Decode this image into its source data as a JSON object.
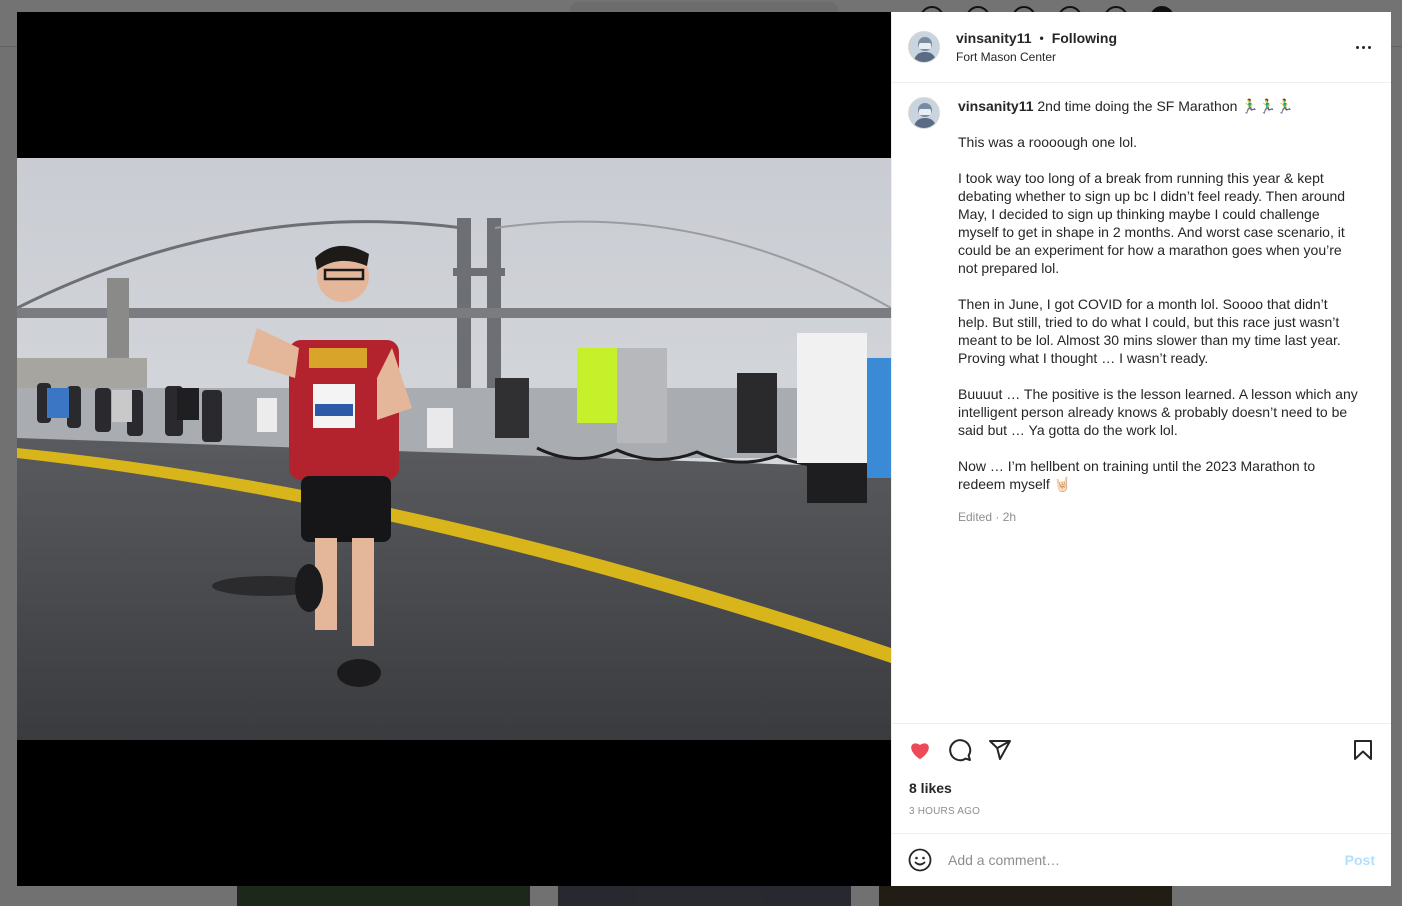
{
  "post": {
    "username": "vinsanity11",
    "separator": "•",
    "follow_status": "Following",
    "location": "Fort Mason Center"
  },
  "caption": {
    "username": "vinsanity11",
    "first_line": "2nd time doing the SF Marathon 🏃‍♂️🏃‍♂️🏃‍♂️",
    "paragraphs": [
      "This was a roooough one lol.",
      "I took way too long of a break from running this year & kept debating whether to sign up bc I didn’t feel ready. Then around May, I decided to sign up thinking maybe I could challenge myself to get in shape in 2 months. And worst case scenario, it could be an experiment for how a marathon goes when you’re not prepared lol.",
      "Then in June, I got COVID for a month lol. Soooo that didn’t help. But still, tried to do what I could, but this race just wasn’t meant to be lol. Almost 30 mins slower than my time last year. Proving what I thought … I wasn’t ready.",
      "Buuuut … The positive is the lesson learned. A lesson which any intelligent person already knows & probably doesn’t need to be said but … Ya gotta do the work lol.",
      "Now … I’m hellbent on training until the 2023 Marathon to redeem myself 🤘🏻"
    ],
    "meta": "Edited · 2h"
  },
  "engagement": {
    "likes": "8 likes",
    "timestamp": "3 HOURS AGO",
    "liked": true
  },
  "comment_box": {
    "placeholder": "Add a comment…",
    "post_label": "Post"
  },
  "colors": {
    "heart": "#ed4956",
    "post_disabled": "#b2dffc",
    "muted": "#8e8e8e"
  },
  "icons": [
    "more-options-icon",
    "heart-icon",
    "comment-icon",
    "share-icon",
    "bookmark-icon",
    "emoji-icon"
  ]
}
